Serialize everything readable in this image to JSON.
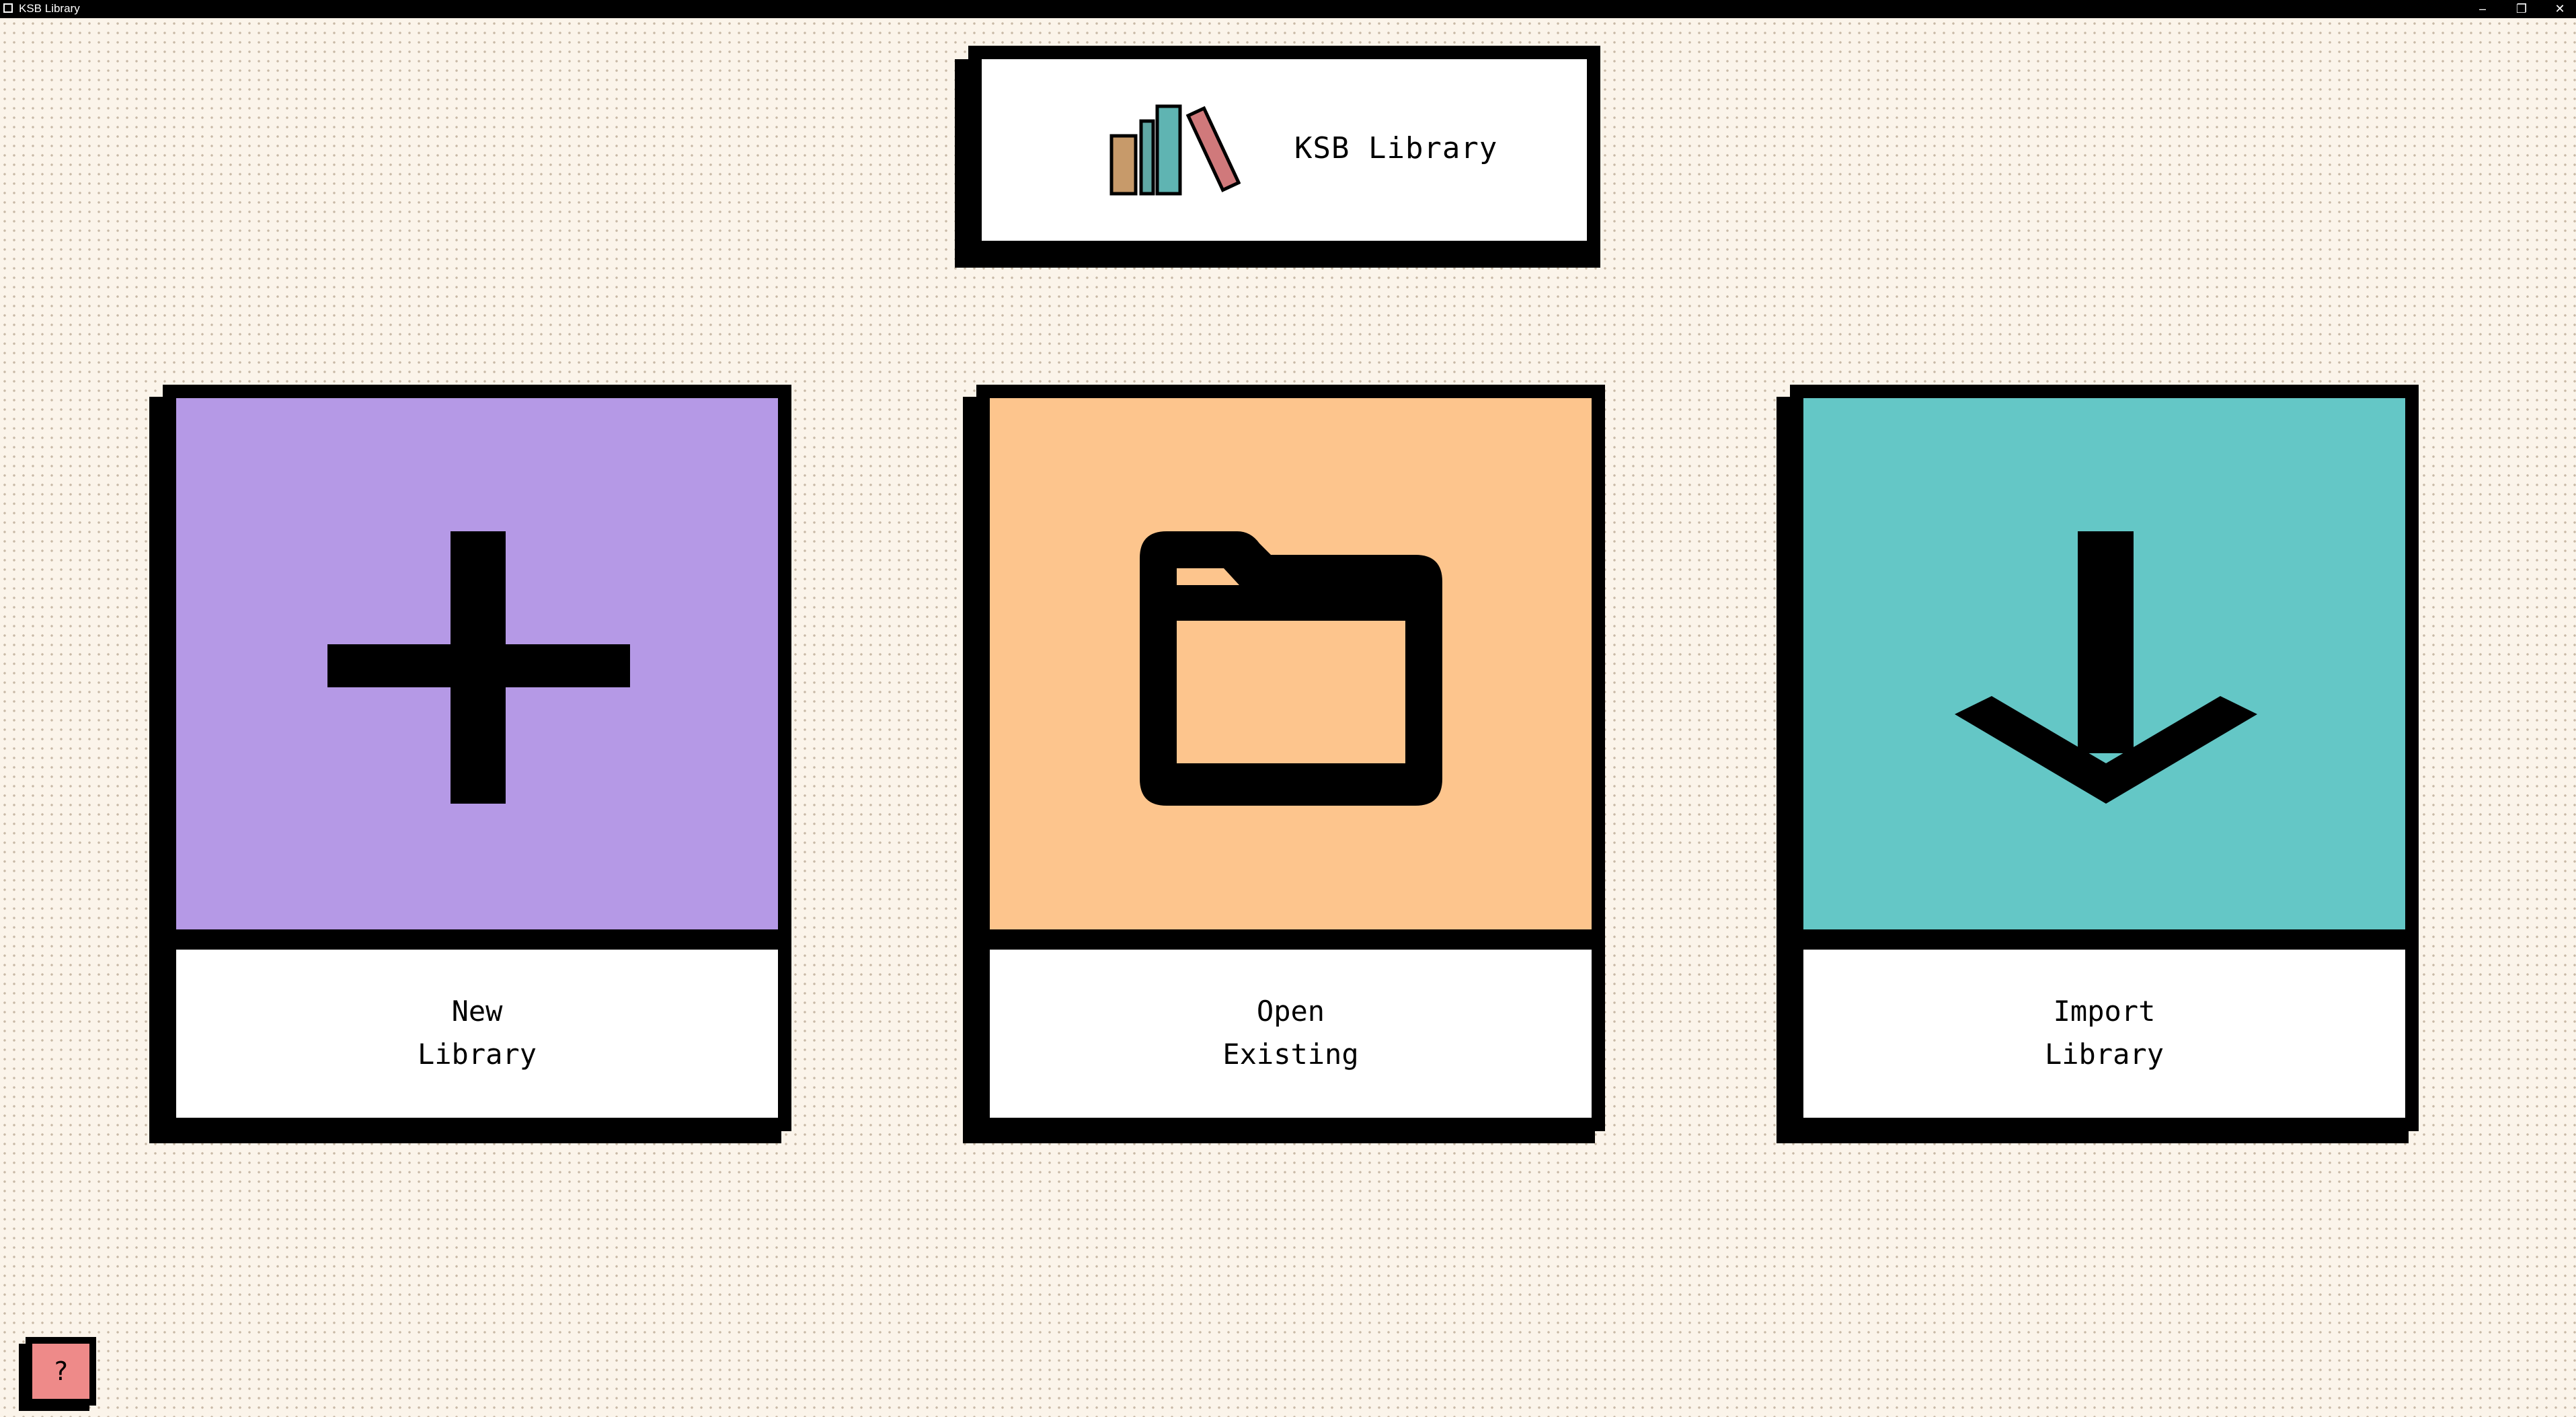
{
  "window": {
    "title": "KSB Library",
    "controls": [
      "–",
      "❐",
      "✕"
    ]
  },
  "header": {
    "title": "KSB Library",
    "logo_icon": "bookshelf-icon"
  },
  "cards": [
    {
      "id": "new",
      "label_line1": "New",
      "label_line2": "Library",
      "icon": "plus-icon",
      "color": "#b599e6"
    },
    {
      "id": "open",
      "label_line1": "Open",
      "label_line2": "Existing",
      "icon": "folder-icon",
      "color": "#fdc58d"
    },
    {
      "id": "import",
      "label_line1": "Import",
      "label_line2": "Library",
      "icon": "download-arrow-icon",
      "color": "#64c7c6"
    }
  ],
  "help": {
    "label": "?",
    "color": "#ee8a89"
  }
}
